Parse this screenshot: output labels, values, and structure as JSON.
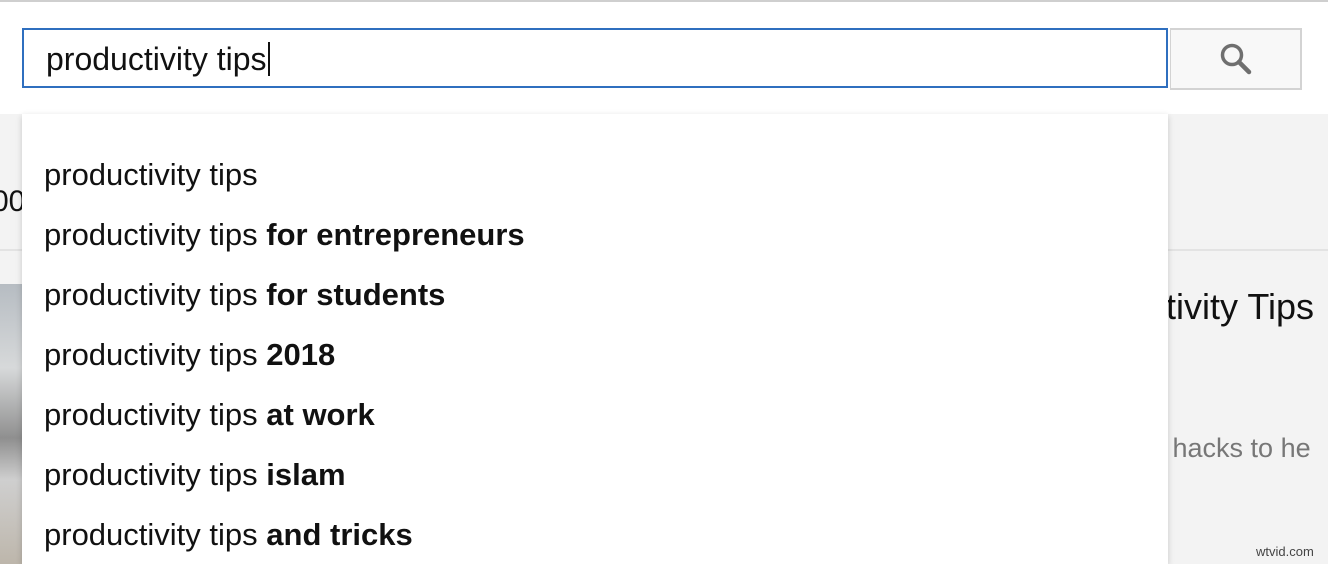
{
  "search": {
    "query": "productivity tips",
    "button_icon": "search-icon"
  },
  "suggestions": [
    {
      "prefix": "productivity tips",
      "completion": ""
    },
    {
      "prefix": "productivity tips",
      "completion": "for entrepreneurs"
    },
    {
      "prefix": "productivity tips",
      "completion": "for students"
    },
    {
      "prefix": "productivity tips",
      "completion": "2018"
    },
    {
      "prefix": "productivity tips",
      "completion": "at work"
    },
    {
      "prefix": "productivity tips",
      "completion": "islam"
    },
    {
      "prefix": "productivity tips",
      "completion": "and tricks"
    }
  ],
  "background": {
    "left_fragment": "00",
    "right_title_fragment": "ctivity Tips",
    "right_desc_fragment": "d hacks to he"
  },
  "watermark": "wtvid.com",
  "colors": {
    "focus_border": "#2f6fbf",
    "button_bg": "#f8f8f8"
  }
}
